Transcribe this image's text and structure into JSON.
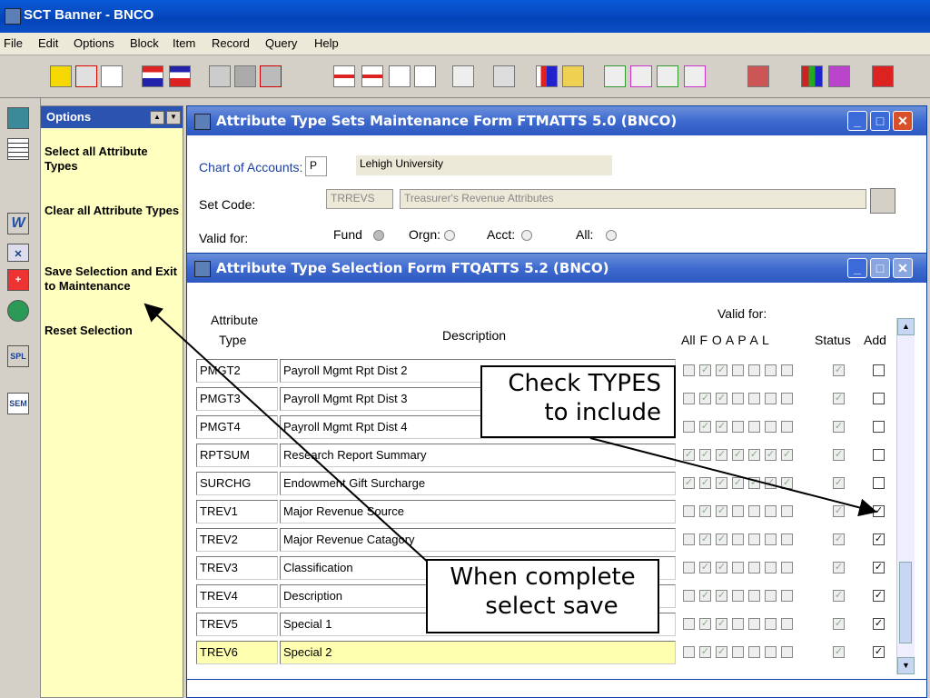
{
  "app": {
    "title": "SCT Banner - BNCO"
  },
  "menu": [
    "File",
    "Edit",
    "Options",
    "Block",
    "Item",
    "Record",
    "Query",
    "Help"
  ],
  "left_tools": [
    "calculator-icon",
    "grid-icon",
    "w-icon",
    "x-icon",
    "plus-icon",
    "globe-icon",
    "spl-icon",
    "sem-icon"
  ],
  "left_tool_text": {
    "spl": "SPL",
    "sem": "SEM"
  },
  "options_panel": {
    "title": "Options",
    "items": [
      "Select all Attribute Types",
      "Clear all Attribute Types",
      "Save Selection and Exit to Maintenance",
      "Reset Selection"
    ]
  },
  "form1": {
    "title": "Attribute Type Sets Maintenance Form  FTMATTS  5.0  (BNCO)",
    "chart_label": "Chart of Accounts:",
    "chart_value": "P",
    "chart_name": "Lehigh University",
    "set_code_label": "Set Code:",
    "set_code_value": "TRREVS",
    "set_code_desc": "Treasurer's Revenue Attributes",
    "valid_for_label": "Valid for:",
    "fund_label": "Fund",
    "orgn_label": "Orgn:",
    "acct_label": "Acct:",
    "all_label": "All:"
  },
  "form2": {
    "title": "Attribute Type Selection Form  FTQATTS  5.2  (BNCO)",
    "col_type_1": "Attribute",
    "col_type_2": "Type",
    "col_desc": "Description",
    "valid_for": "Valid for:",
    "col_flags": "All F O A P A L",
    "col_status": "Status",
    "col_add": "Add",
    "rows": [
      {
        "code": "PMGT2",
        "desc": "Payroll Mgmt Rpt Dist 2",
        "flags": [
          0,
          1,
          1,
          0,
          0,
          0,
          0
        ],
        "status": 1,
        "add": 0
      },
      {
        "code": "PMGT3",
        "desc": "Payroll Mgmt Rpt Dist 3",
        "flags": [
          0,
          1,
          1,
          0,
          0,
          0,
          0
        ],
        "status": 1,
        "add": 0
      },
      {
        "code": "PMGT4",
        "desc": "Payroll Mgmt Rpt Dist 4",
        "flags": [
          0,
          1,
          1,
          0,
          0,
          0,
          0
        ],
        "status": 1,
        "add": 0
      },
      {
        "code": "RPTSUM",
        "desc": "Research Report Summary",
        "flags": [
          1,
          1,
          1,
          1,
          1,
          1,
          1
        ],
        "status": 1,
        "add": 0
      },
      {
        "code": "SURCHG",
        "desc": "Endowment Gift Surcharge",
        "flags": [
          1,
          1,
          1,
          1,
          1,
          1,
          1
        ],
        "status": 1,
        "add": 0
      },
      {
        "code": "TREV1",
        "desc": "Major Revenue Source",
        "flags": [
          0,
          1,
          1,
          0,
          0,
          0,
          0
        ],
        "status": 1,
        "add": 1
      },
      {
        "code": "TREV2",
        "desc": "Major Revenue Catagory",
        "flags": [
          0,
          1,
          1,
          0,
          0,
          0,
          0
        ],
        "status": 1,
        "add": 1
      },
      {
        "code": "TREV3",
        "desc": "Classification",
        "flags": [
          0,
          1,
          1,
          0,
          0,
          0,
          0
        ],
        "status": 1,
        "add": 1
      },
      {
        "code": "TREV4",
        "desc": "Description",
        "flags": [
          0,
          1,
          1,
          0,
          0,
          0,
          0
        ],
        "status": 1,
        "add": 1
      },
      {
        "code": "TREV5",
        "desc": "Special 1",
        "flags": [
          0,
          1,
          1,
          0,
          0,
          0,
          0
        ],
        "status": 1,
        "add": 1
      },
      {
        "code": "TREV6",
        "desc": "Special 2",
        "flags": [
          0,
          1,
          1,
          0,
          0,
          0,
          0
        ],
        "status": 1,
        "add": 1
      }
    ]
  },
  "callouts": {
    "check": [
      "Check TYPES",
      "to include"
    ],
    "save": [
      "When complete",
      "select save"
    ]
  },
  "colors": {
    "titlebar": "#0443b8",
    "options_bg": "#ffffc0",
    "highlight_row": "#ffffb0"
  }
}
